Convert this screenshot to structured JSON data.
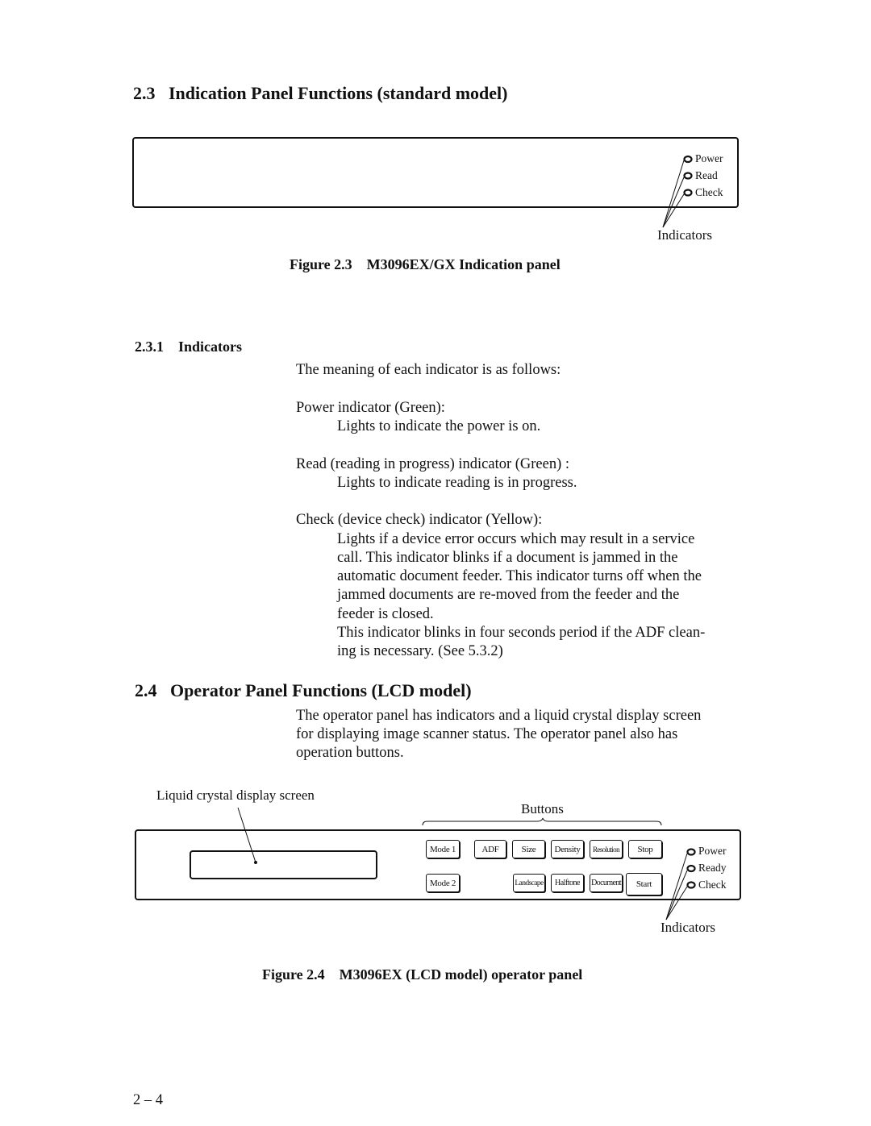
{
  "section_2_3": {
    "number": "2.3",
    "title": "Indication Panel Functions (standard model)"
  },
  "figure_2_3": {
    "indicators": [
      "Power",
      "Read",
      "Check"
    ],
    "indicators_label": "Indicators",
    "caption_number": "Figure 2.3",
    "caption_text": "M3096EX/GX Indication panel"
  },
  "section_2_3_1": {
    "number": "2.3.1",
    "title": "Indicators",
    "intro": "The meaning of each indicator is as follows:",
    "items": [
      {
        "term": "Power indicator (Green):",
        "lines": [
          "Lights to indicate the power is on."
        ]
      },
      {
        "term": "Read (reading in progress) indicator (Green) :",
        "lines": [
          "Lights to indicate reading is in progress."
        ]
      },
      {
        "term": "Check (device check) indicator (Yellow):",
        "lines": [
          "Lights if a device error occurs which may result in a service",
          "call.  This indicator blinks if a document is jammed in the",
          "automatic document feeder.  This indicator turns off when the",
          "jammed documents are re-moved from the feeder and the",
          "feeder is closed.",
          "This indicator blinks in four seconds period if the ADF clean-",
          "ing is necessary. (See 5.3.2)"
        ]
      }
    ]
  },
  "section_2_4": {
    "number": "2.4",
    "title": "Operator Panel Functions (LCD model)",
    "body": [
      "The operator panel has indicators and a liquid crystal display screen",
      "for displaying image scanner status.  The operator panel also has",
      "operation buttons."
    ]
  },
  "figure_2_4": {
    "lcd_label": "Liquid crystal display screen",
    "buttons_label": "Buttons",
    "buttons_row1": [
      "Mode 1",
      "ADF",
      "Size",
      "Density",
      "Resolution",
      "Stop"
    ],
    "buttons_row2": [
      "Mode 2",
      "Landscape",
      "Halftone",
      "Document",
      "Start"
    ],
    "indicators": [
      "Power",
      "Ready",
      "Check"
    ],
    "indicators_label": "Indicators",
    "caption_number": "Figure 2.4",
    "caption_text": "M3096EX (LCD model) operator panel"
  },
  "page_number": "2 – 4"
}
